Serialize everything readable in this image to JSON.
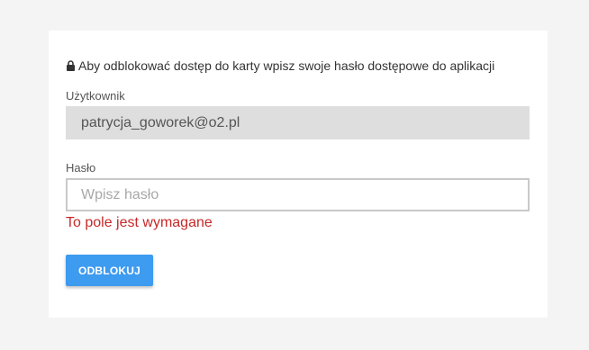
{
  "notice": {
    "icon": "lock-icon",
    "text": "Aby odblokować dostęp do karty wpisz swoje hasło dostępowe do aplikacji"
  },
  "user_field": {
    "label": "Użytkownik",
    "value": "patrycja_goworek@o2.pl"
  },
  "password_field": {
    "label": "Hasło",
    "value": "",
    "placeholder": "Wpisz hasło",
    "error": "To pole jest wymagane"
  },
  "unlock_button": {
    "label": "ODBLOKUJ"
  },
  "colors": {
    "page_background": "#f4f4f4",
    "card_background": "#ffffff",
    "readonly_field": "#dedede",
    "error": "#c62828",
    "button": "#3d9bf0"
  }
}
